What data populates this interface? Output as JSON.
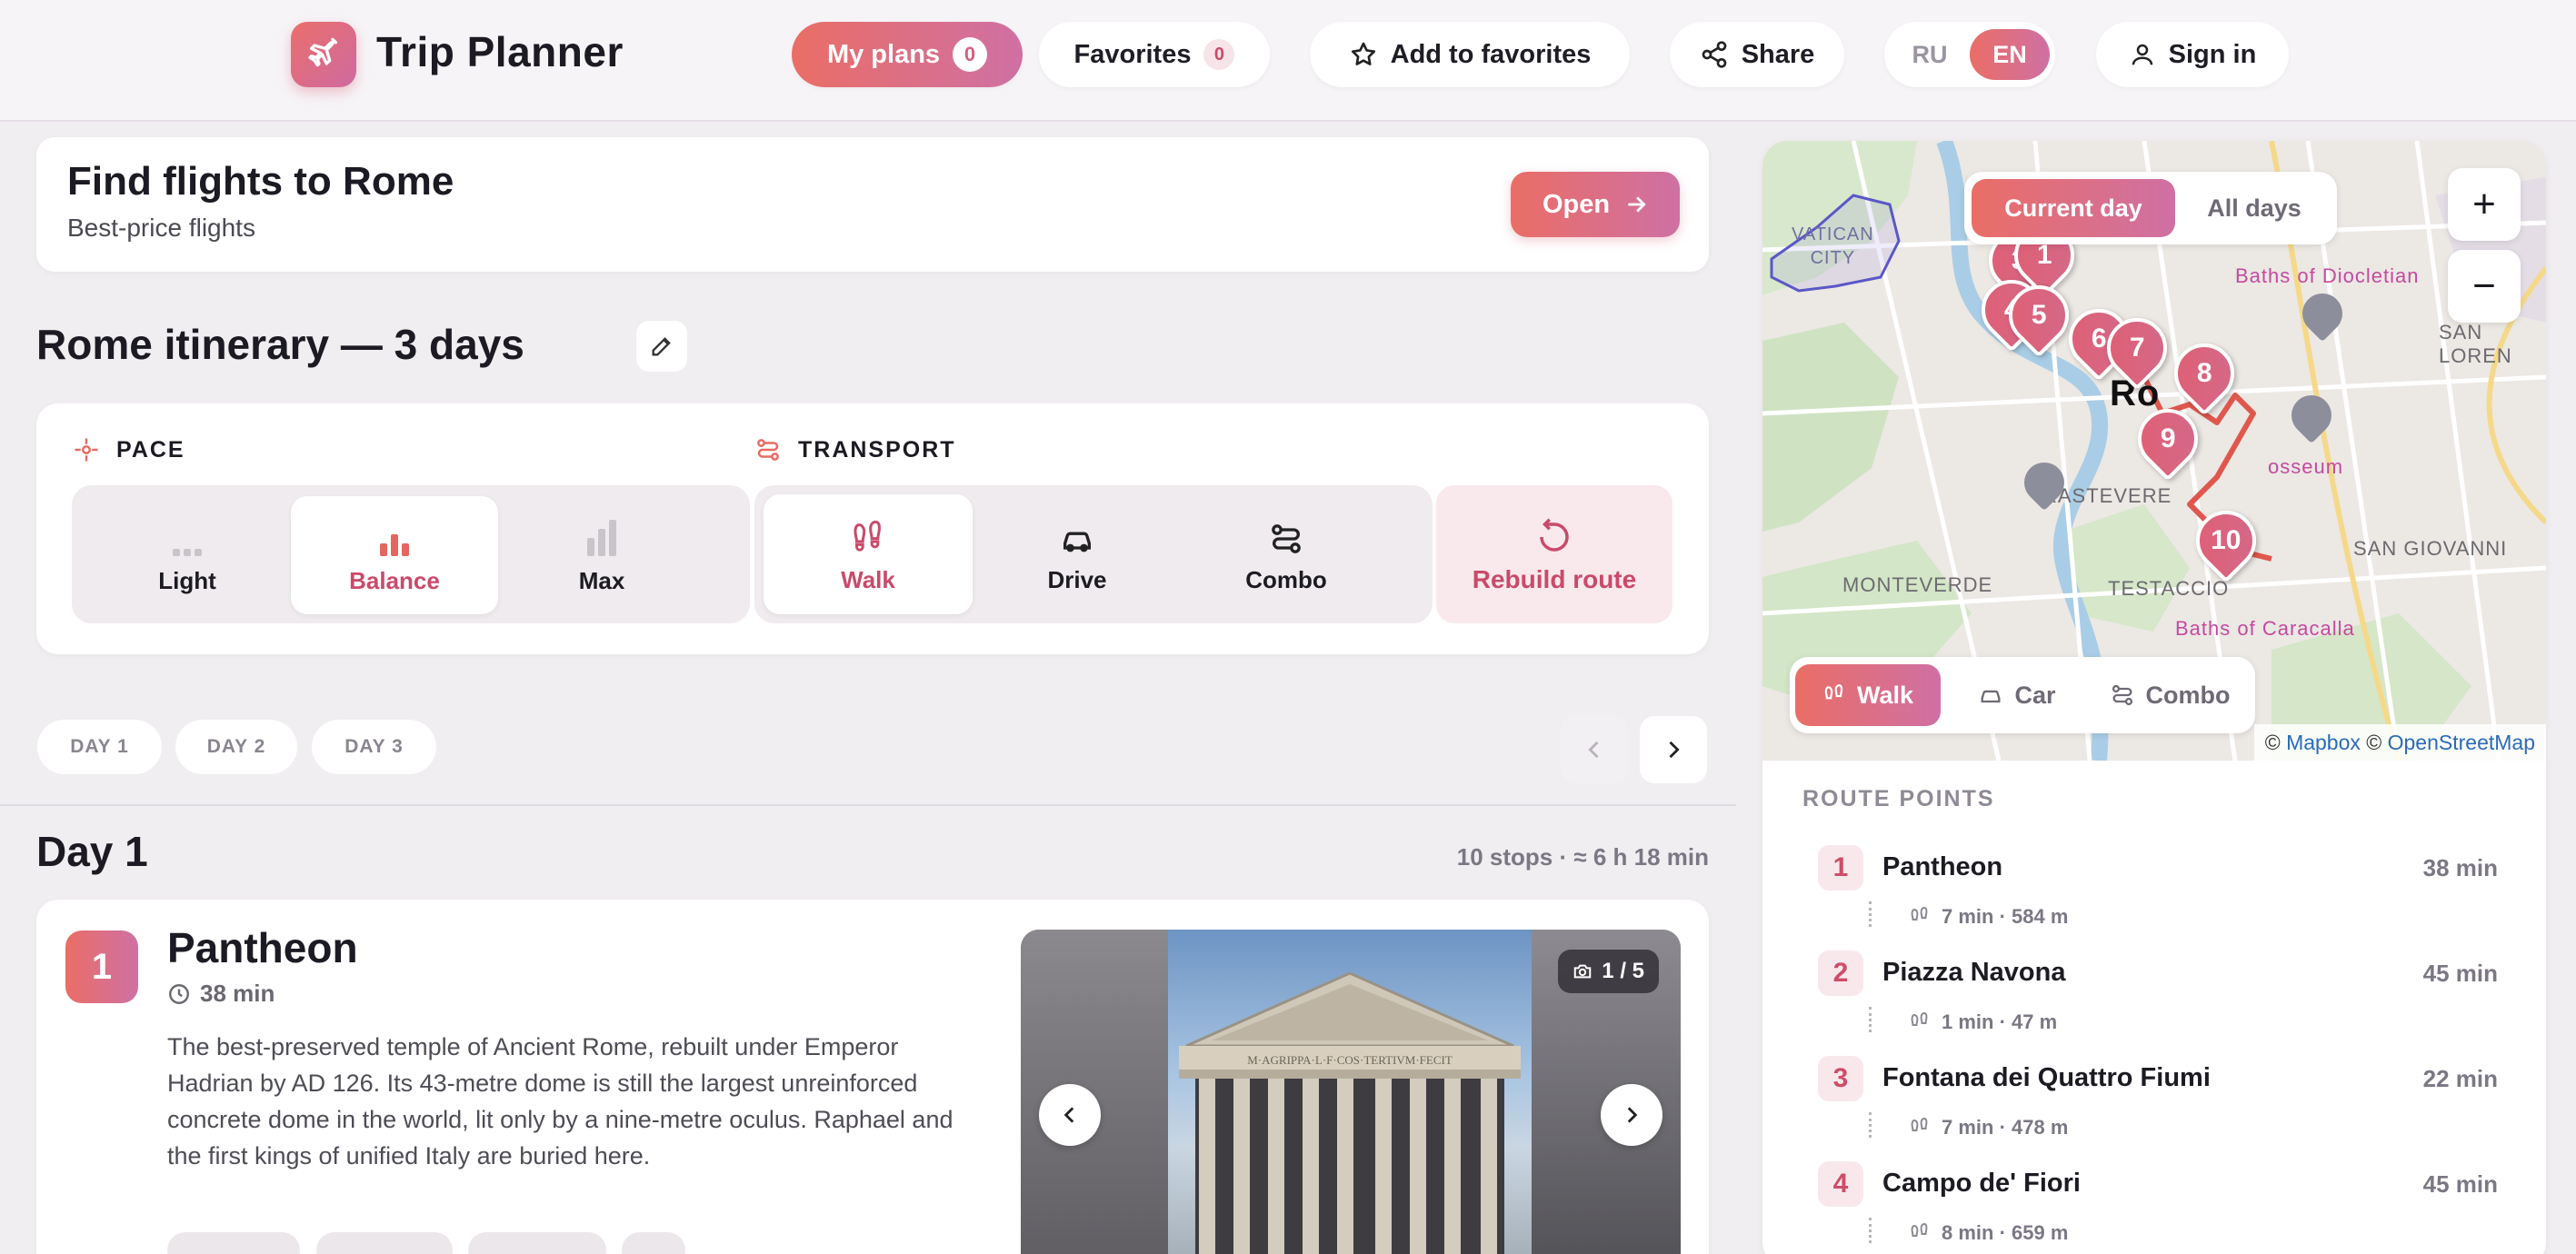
{
  "app": {
    "title": "Trip Planner"
  },
  "header": {
    "my_plans": {
      "label": "My plans",
      "count": "0"
    },
    "favorites": {
      "label": "Favorites",
      "count": "0"
    },
    "add_favorites": "Add to favorites",
    "share": "Share",
    "lang": {
      "ru": "RU",
      "en": "EN"
    },
    "sign_in": "Sign in"
  },
  "flights": {
    "title": "Find flights to Rome",
    "subtitle": "Best-price flights",
    "button": "Open"
  },
  "itinerary": {
    "title": "Rome itinerary — 3 days"
  },
  "settings": {
    "pace_label": "PACE",
    "transport_label": "TRANSPORT",
    "pace": [
      "Light",
      "Balance",
      "Max"
    ],
    "transport": [
      "Walk",
      "Drive",
      "Combo"
    ],
    "rebuild": "Rebuild route"
  },
  "days": {
    "tabs": [
      "DAY 1",
      "DAY 2",
      "DAY 3"
    ]
  },
  "day": {
    "title": "Day 1",
    "summary": "10 stops · ≈ 6 h 18 min"
  },
  "stop": {
    "number": "1",
    "name": "Pantheon",
    "duration": "38 min",
    "description": "The best-preserved temple of Ancient Rome, rebuilt under Emperor Hadrian by AD 126. Its 43-metre dome is still the largest unreinforced concrete dome in the world, lit only by a nine-metre oculus. Raphael and the first kings of unified Italy are buried here.",
    "photo_counter": "1 / 5",
    "frieze_text": "M·AGRIPPA·L·F·COS·TERTIVM·FECIT"
  },
  "map": {
    "toggle": {
      "current": "Current day",
      "all": "All days"
    },
    "zoom_in": "+",
    "zoom_out": "−",
    "modes": [
      "Walk",
      "Car",
      "Combo"
    ],
    "attribution": {
      "prefix1": "©",
      "mapbox": "Mapbox",
      "prefix2": "©",
      "osm": "OpenStreetMap"
    },
    "labels": {
      "vatican": "VATICAN\nCITY",
      "diocletian": "Baths of Diocletian",
      "san_lorenzo": "SAN LOREN",
      "roma": "Ro",
      "colosseum": "osseum",
      "trastevere": "RASTEVERE",
      "monteverde": "MONTEVERDE",
      "testaccio": "TESTACCIO",
      "san_giovanni": "SAN GIOVANNI",
      "caracalla": "Baths of Caracalla"
    },
    "markers": [
      "3",
      "1",
      "4",
      "5",
      "6",
      "7",
      "8",
      "9",
      "10"
    ]
  },
  "route": {
    "title": "ROUTE POINTS",
    "points": [
      {
        "num": "1",
        "name": "Pantheon",
        "dur": "38 min",
        "leg": "7 min · 584 m"
      },
      {
        "num": "2",
        "name": "Piazza Navona",
        "dur": "45 min",
        "leg": "1 min · 47 m"
      },
      {
        "num": "3",
        "name": "Fontana dei Quattro Fiumi",
        "dur": "22 min",
        "leg": "7 min · 478 m"
      },
      {
        "num": "4",
        "name": "Campo de' Fiori",
        "dur": "45 min",
        "leg": "8 min · 659 m"
      }
    ]
  },
  "colors": {
    "accent_start": "#ea6e66",
    "accent_end": "#cf70a4",
    "accent_text": "#c94a6a"
  }
}
